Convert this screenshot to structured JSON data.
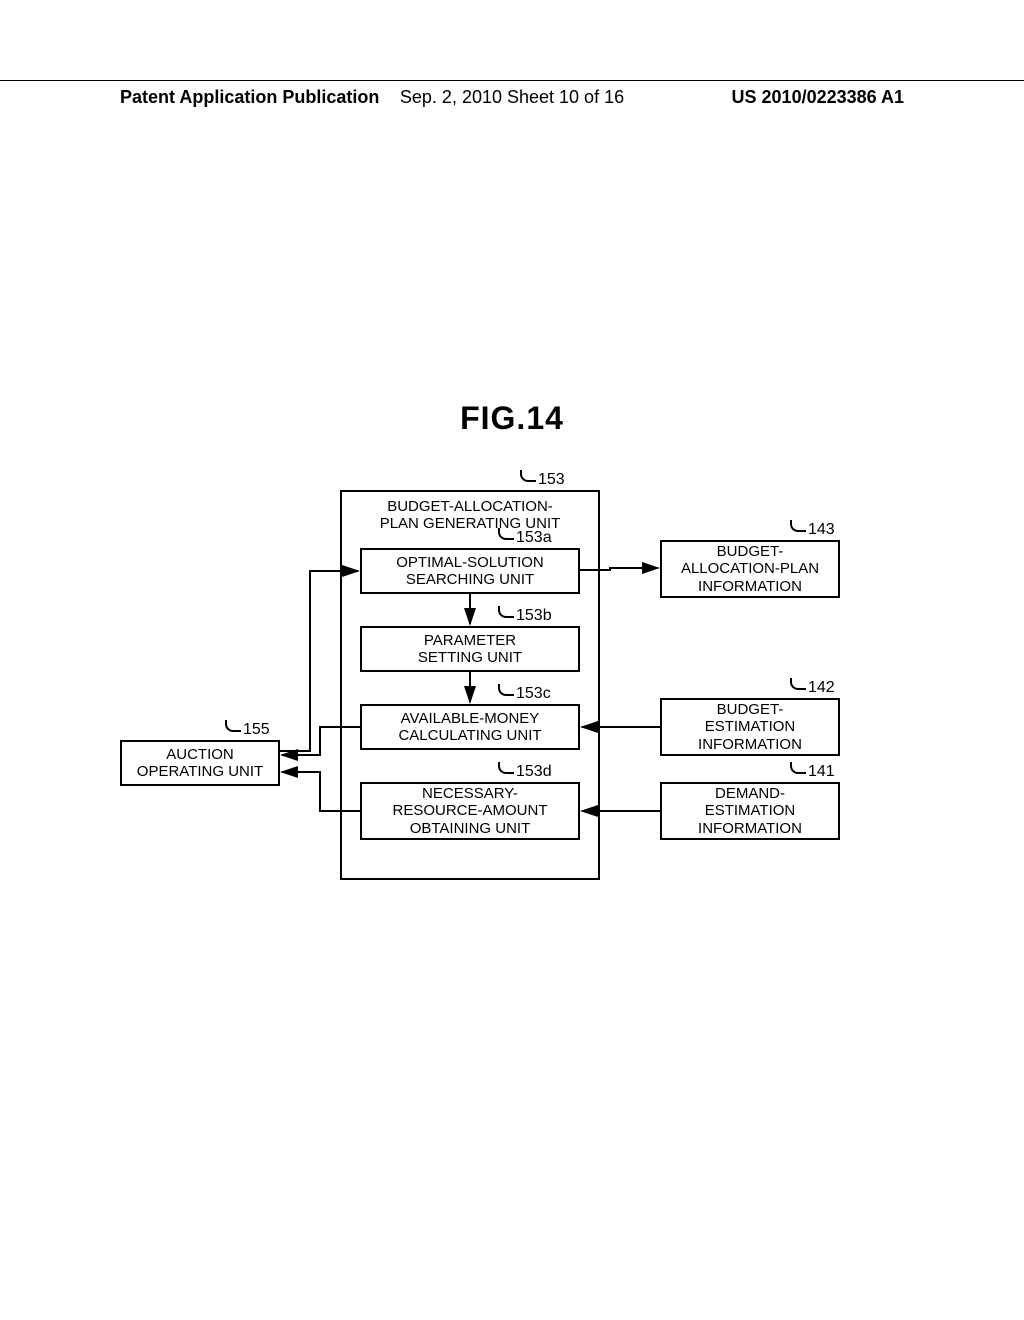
{
  "header": {
    "left": "Patent Application Publication",
    "mid": "Sep. 2, 2010  Sheet 10 of 16",
    "right": "US 2010/0223386 A1"
  },
  "figure_title": "FIG.14",
  "refs": {
    "unit153": "153",
    "unit153a": "153a",
    "unit153b": "153b",
    "unit153c": "153c",
    "unit153d": "153d",
    "unit155": "155",
    "unit143": "143",
    "unit142": "142",
    "unit141": "141"
  },
  "labels": {
    "unit153": "BUDGET-ALLOCATION-\nPLAN GENERATING UNIT",
    "unit153a": "OPTIMAL-SOLUTION\nSEARCHING UNIT",
    "unit153b": "PARAMETER\nSETTING UNIT",
    "unit153c": "AVAILABLE-MONEY\nCALCULATING UNIT",
    "unit153d": "NECESSARY-\nRESOURCE-AMOUNT\nOBTAINING UNIT",
    "unit155": "AUCTION\nOPERATING UNIT",
    "unit143": "BUDGET-\nALLOCATION-PLAN\nINFORMATION",
    "unit142": "BUDGET-\nESTIMATION\nINFORMATION",
    "unit141": "DEMAND-\nESTIMATION\nINFORMATION"
  }
}
